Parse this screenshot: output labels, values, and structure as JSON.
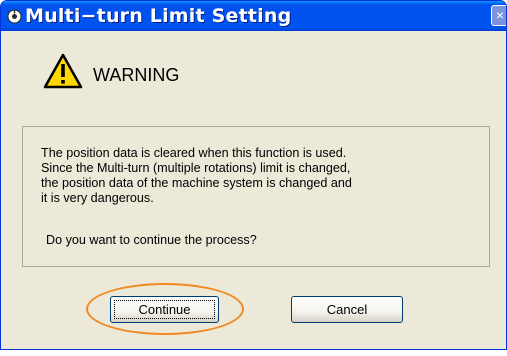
{
  "window": {
    "title": "Multi−turn Limit Setting",
    "title_icon": "app-icon",
    "close_glyph": "×"
  },
  "warning": {
    "icon": "warning-triangle-icon",
    "label": "WARNING"
  },
  "message": {
    "lines": [
      "The position data is cleared when this function is used.",
      "Since the Multi-turn (multiple rotations) limit is changed,",
      "the position data of the machine system is changed and",
      "it is very dangerous."
    ],
    "question": "Do you want to continue the process?"
  },
  "buttons": {
    "continue_label": "Continue",
    "cancel_label": "Cancel"
  },
  "colors": {
    "titlebar": "#0053ee",
    "dialog_bg": "#ece9d8",
    "highlight": "#f08a24",
    "warning_yellow": "#ffd800"
  }
}
